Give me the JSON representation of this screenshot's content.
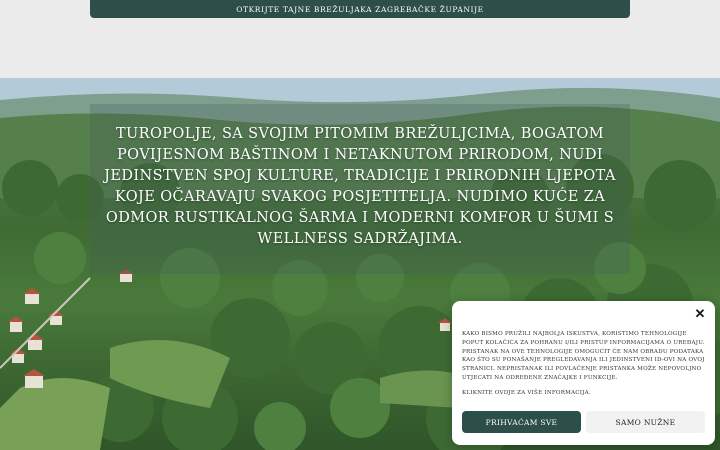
{
  "banner": {
    "text": "OTKRIJTE TAJNE BREŽULJAKA ZAGREBAČKE ŽUPANIJE"
  },
  "hero": {
    "text": "TUROPOLJE, SA SVOJIM PITOMIM BREŽULJCIMA, BOGATOM POVIJESNOM BAŠTINOM I NETAKNUTOM PRIRODOM, NUDI JEDINSTVEN SPOJ KULTURE, TRADICIJE I PRIRODNIH LJEPOTA KOJE OČARAVAJU SVAKOG POSJETITELJA. NUDIMO KUĆE ZA ODMOR RUSTIKALNOG ŠARMA I MODERNI KOMFOR U ŠUMI S WELLNESS SADRŽAJIMA."
  },
  "cookie": {
    "close_icon": "close-icon",
    "text": "KAKO BISMO PRUŽILI NAJBOLJA ISKUSTVA, KORISTIMO TEHNOLOGIJE POPUT KOLAČIĆA ZA POHRANU I/ILI PRISTUP INFORMACIJAMA O UREĐAJU. PRISTANAK NA OVE TEHNOLOGIJE OMOGUĆIT ĆE NAM OBRADU PODATAKA KAO ŠTO SU PONAŠANJE PREGLEDAVANJA ILI JEDINSTVENI ID-OVI NA OVOJ STRANICI. NEPRISTANAK ILI POVLAČENJE PRISTANKA MOŽE NEPOVOLJNO UTJECATI NA ODREĐENE ZNAČAJKE I FUNKCIJE.",
    "link": "KLIKNITE OVDJE ZA VIŠE INFORMACIJA.",
    "accept_label": "PRIHVAĆAM SVE",
    "necessary_label": "SAMO NUŽNE"
  },
  "colors": {
    "accent": "#2c4f4a",
    "page_bg": "#ebebeb"
  }
}
